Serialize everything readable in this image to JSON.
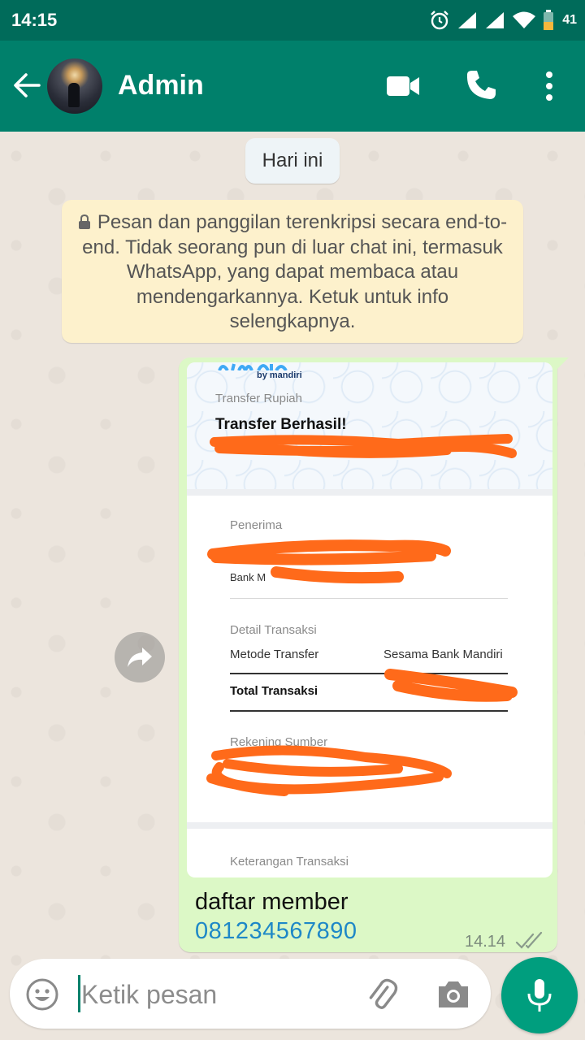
{
  "status_bar": {
    "time": "14:15",
    "battery_level": "41"
  },
  "header": {
    "contact_name": "Admin",
    "icons": [
      "back-arrow-icon",
      "avatar",
      "video-call-icon",
      "phone-icon",
      "more-vert-icon"
    ]
  },
  "chat": {
    "date_chip": "Hari ini",
    "encryption_notice": "Pesan dan panggilan terenkripsi secara end-to-end. Tidak seorang pun di luar chat ini, termasuk WhatsApp, yang dapat membaca atau mendengarkannya. Ketuk untuk info selengkapnya.",
    "message": {
      "receipt": {
        "brand_sub": "by mandiri",
        "category": "Transfer Rupiah",
        "title": "Transfer Berhasil!",
        "recipient_label": "Penerima",
        "recipient_bank_partial": "Bank M",
        "detail_label": "Detail Transaksi",
        "method_label": "Metode Transfer",
        "method_value": "Sesama Bank Mandiri",
        "total_label": "Total Transaksi",
        "source_label": "Rekening Sumber",
        "note_label": "Keterangan Transaksi"
      },
      "caption_line1": "daftar member",
      "caption_link": "081234567890",
      "time": "14.14",
      "status": "read"
    }
  },
  "composer": {
    "placeholder": "Ketik pesan"
  },
  "colors": {
    "header": "#00806B",
    "status_bar": "#006B5A",
    "outgoing_bubble": "#DCF8C6",
    "notice_bg": "#FDF1CC",
    "link": "#1E88C7",
    "mic_button": "#009E7E",
    "redaction": "#FF6A1A"
  }
}
